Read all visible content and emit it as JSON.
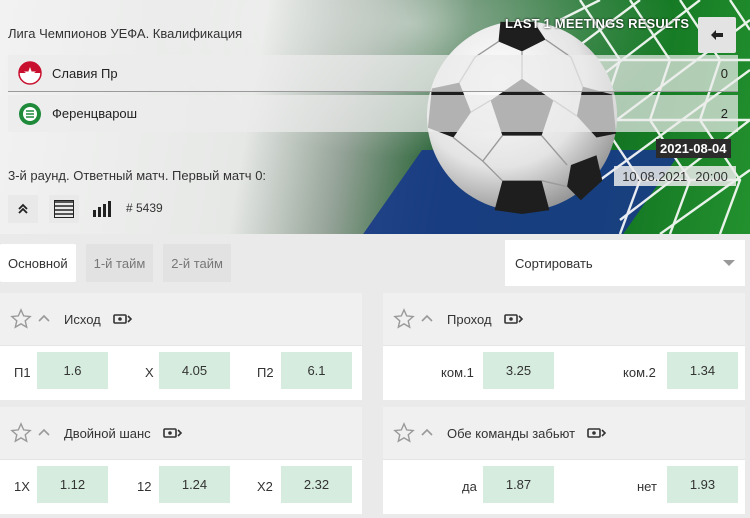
{
  "header": {
    "league": "Лига Чемпионов УЕФА. Квалификация",
    "meetings_label": "LAST 1 MEETINGS RESULTS",
    "back_icon": "arrow-left-icon",
    "teams": [
      {
        "name": "Славия Пр",
        "score": "0",
        "logo": "slavia-logo"
      },
      {
        "name": "Ференцварош",
        "score": "2",
        "logo": "ferencvaros-logo"
      }
    ],
    "meeting_date": "2021-08-04",
    "round": "3-й раунд. Ответный матч. Первый матч 0:",
    "match_date": "10.08.2021",
    "match_time": "20:00",
    "game_id": "# 5439"
  },
  "tabs": [
    "Основной",
    "1-й тайм",
    "2-й тайм"
  ],
  "sort": {
    "label": "Сортировать"
  },
  "markets": [
    {
      "title": "Исход",
      "outcomes": [
        {
          "label": "П1",
          "odd": "1.6"
        },
        {
          "label": "X",
          "odd": "4.05"
        },
        {
          "label": "П2",
          "odd": "6.1"
        }
      ]
    },
    {
      "title": "Проход",
      "outcomes": [
        {
          "label": "ком.1",
          "odd": "3.25"
        },
        {
          "label": "ком.2",
          "odd": "1.34"
        }
      ]
    },
    {
      "title": "Двойной шанс",
      "outcomes": [
        {
          "label": "1X",
          "odd": "1.12"
        },
        {
          "label": "12",
          "odd": "1.24"
        },
        {
          "label": "X2",
          "odd": "2.32"
        }
      ]
    },
    {
      "title": "Обе команды забьют",
      "outcomes": [
        {
          "label": "да",
          "odd": "1.87"
        },
        {
          "label": "нет",
          "odd": "1.93"
        }
      ]
    }
  ],
  "colors": {
    "odd_bg": "#d6ecdf",
    "date_badge": "#2b2b2b",
    "tab_active": "#ffffff"
  }
}
